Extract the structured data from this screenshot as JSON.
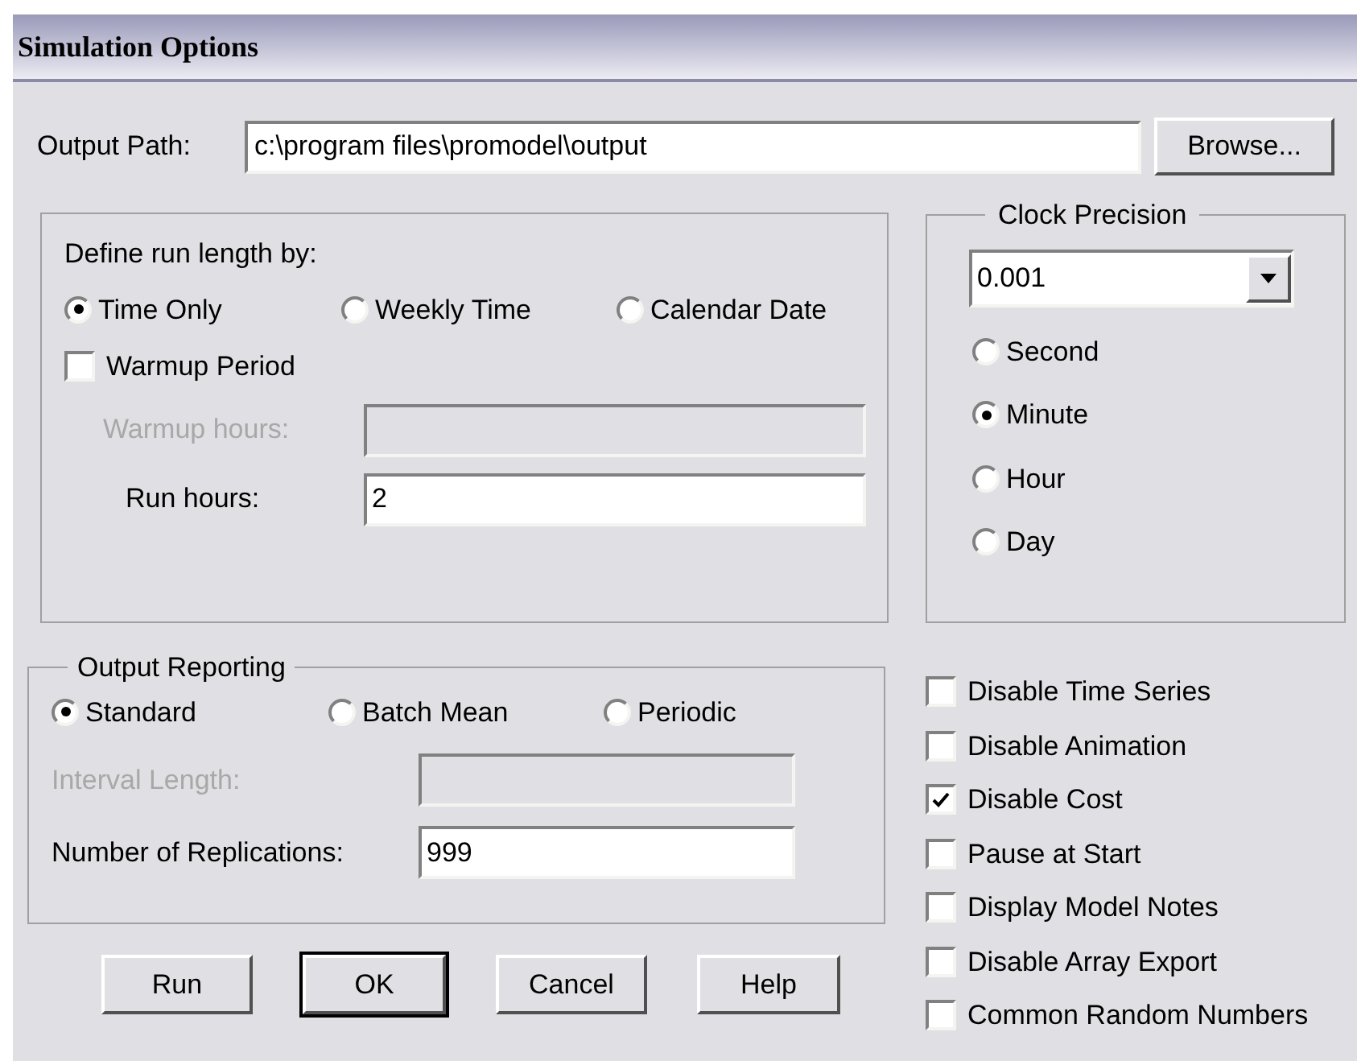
{
  "title": "Simulation Options",
  "output_path": {
    "label": "Output Path:",
    "value": "c:\\program files\\promodel\\output"
  },
  "browse_button": {
    "label": "Browse..."
  },
  "run_length": {
    "label": "Define run length by:",
    "options": [
      {
        "label": "Time Only",
        "selected": true
      },
      {
        "label": "Weekly Time",
        "selected": false
      },
      {
        "label": "Calendar Date",
        "selected": false
      }
    ],
    "warmup": {
      "label": "Warmup Period",
      "checked": false
    },
    "fields": [
      {
        "label": "Warmup hours:",
        "disabled": true
      },
      {
        "label": "Run hours:",
        "value": "2",
        "disabled": false
      }
    ]
  },
  "clock_precision": {
    "title": "Clock Precision",
    "dropdown": {
      "value": "0.001"
    },
    "options": [
      {
        "label": "Second",
        "selected": false
      },
      {
        "label": "Minute",
        "selected": true
      },
      {
        "label": "Hour",
        "selected": false
      },
      {
        "label": "Day",
        "selected": false
      }
    ]
  },
  "output_reporting": {
    "title": "Output Reporting",
    "options": [
      {
        "label": "Standard",
        "selected": true
      },
      {
        "label": "Batch Mean",
        "selected": false
      },
      {
        "label": "Periodic",
        "selected": false
      }
    ],
    "fields": [
      {
        "label": "Interval Length:",
        "disabled": true
      },
      {
        "label": "Number of Replications:",
        "value": "999",
        "disabled": false
      }
    ]
  },
  "checkboxes": [
    {
      "label": "Disable Time Series",
      "checked": false
    },
    {
      "label": "Disable Animation",
      "checked": false
    },
    {
      "label": "Disable Cost",
      "checked": true
    },
    {
      "label": "Pause at Start",
      "checked": false
    },
    {
      "label": "Display Model Notes",
      "checked": false
    },
    {
      "label": "Disable Array Export",
      "checked": false
    },
    {
      "label": "Common Random Numbers",
      "checked": false
    }
  ],
  "buttons": [
    {
      "label": "Run",
      "default": false
    },
    {
      "label": "OK",
      "default": true
    },
    {
      "label": "Cancel",
      "default": false
    },
    {
      "label": "Help",
      "default": false
    }
  ]
}
